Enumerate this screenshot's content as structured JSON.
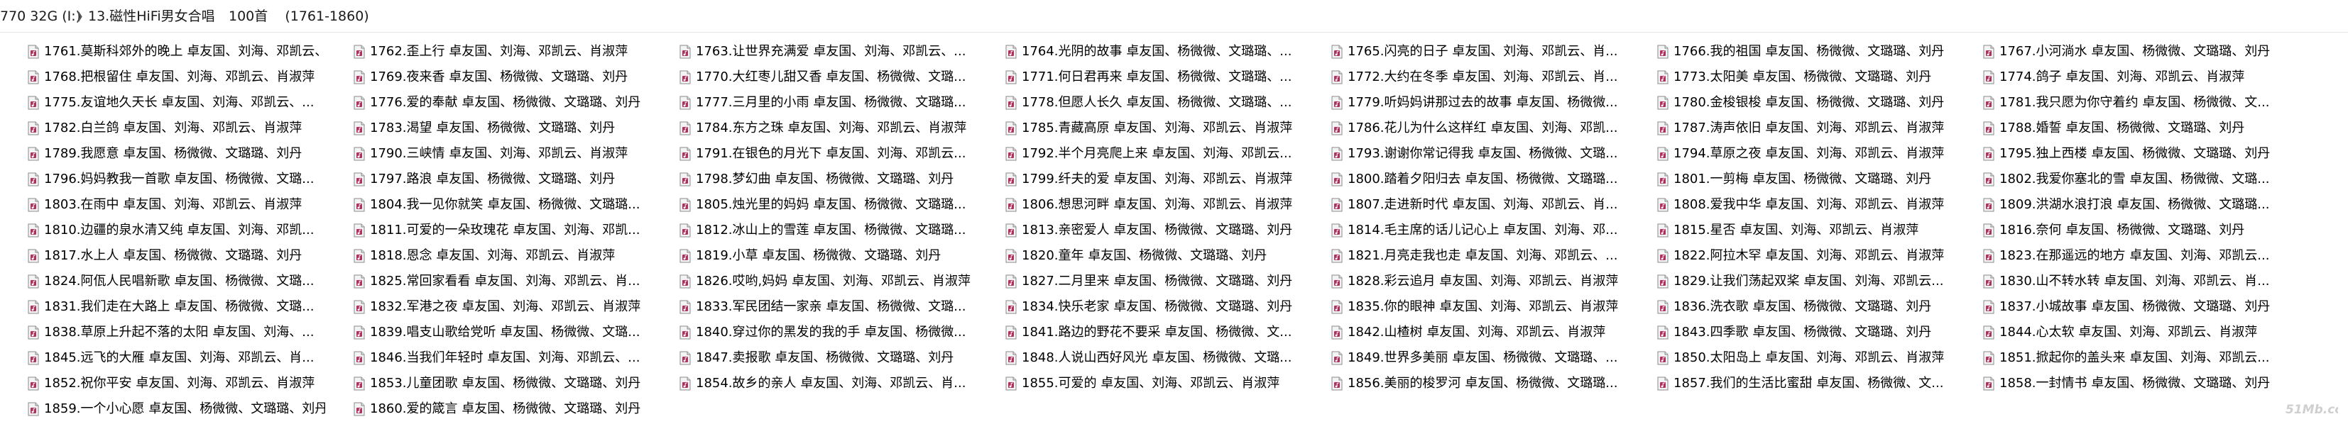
{
  "breadcrumb": {
    "drive": "770 32G (I:)",
    "folder": "13.磁性HiFi男女合唱"
  },
  "item_count": "100首",
  "range": "(1761-1860)",
  "icon": "music-file-icon",
  "accent": "#b03060",
  "files": [
    [
      "1761.莫斯科郊外的晚上 卓友国、刘海、邓凯云、...",
      "1768.把根留住 卓友国、刘海、邓凯云、肖淑萍",
      "1775.友谊地久天长 卓友国、刘海、邓凯云、...",
      "1782.白兰鸽 卓友国、刘海、邓凯云、肖淑萍",
      "1789.我愿意 卓友国、杨微微、文璐璐、刘丹",
      "1796.妈妈教我一首歌 卓友国、杨微微、文璐...",
      "1803.在雨中 卓友国、刘海、邓凯云、肖淑萍",
      "1810.边疆的泉水清又纯 卓友国、刘海、邓凯...",
      "1817.水上人 卓友国、杨微微、文璐璐、刘丹",
      "1824.阿佤人民唱新歌 卓友国、杨微微、文璐...",
      "1831.我们走在大路上 卓友国、杨微微、文璐...",
      "1838.草原上升起不落的太阳 卓友国、刘海、...",
      "1845.远飞的大雁 卓友国、刘海、邓凯云、肖...",
      "1852.祝你平安 卓友国、刘海、邓凯云、肖淑萍",
      "1859.一个小心愿 卓友国、杨微微、文璐璐、刘丹"
    ],
    [
      "1762.歪上行 卓友国、刘海、邓凯云、肖淑萍",
      "1769.夜来香 卓友国、杨微微、文璐璐、刘丹",
      "1776.爱的奉献 卓友国、杨微微、文璐璐、刘丹",
      "1783.渴望 卓友国、杨微微、文璐璐、刘丹",
      "1790.三峡情 卓友国、刘海、邓凯云、肖淑萍",
      "1797.路浪 卓友国、杨微微、文璐璐、刘丹",
      "1804.我一见你就笑 卓友国、杨微微、文璐璐...",
      "1811.可爱的一朵玫瑰花 卓友国、刘海、邓凯...",
      "1818.恩念 卓友国、刘海、邓凯云、肖淑萍",
      "1825.常回家看看 卓友国、刘海、邓凯云、肖...",
      "1832.军港之夜 卓友国、刘海、邓凯云、肖淑萍",
      "1839.唱支山歌给党听 卓友国、杨微微、文璐...",
      "1846.当我们年轻时 卓友国、刘海、邓凯云、...",
      "1853.儿童团歌 卓友国、杨微微、文璐璐、刘丹",
      "1860.爱的箴言 卓友国、杨微微、文璐璐、刘丹"
    ],
    [
      "1763.让世界充满爱 卓友国、刘海、邓凯云、...",
      "1770.大红枣儿甜又香 卓友国、杨微微、文璐...",
      "1777.三月里的小雨 卓友国、杨微微、文璐璐...",
      "1784.东方之珠 卓友国、刘海、邓凯云、肖淑萍",
      "1791.在银色的月光下 卓友国、刘海、邓凯云...",
      "1798.梦幻曲 卓友国、杨微微、文璐璐、刘丹",
      "1805.烛光里的妈妈 卓友国、杨微微、文璐璐...",
      "1812.冰山上的雪莲 卓友国、杨微微、文璐璐...",
      "1819.小草 卓友国、杨微微、文璐璐、刘丹",
      "1826.哎哟,妈妈 卓友国、刘海、邓凯云、肖淑萍",
      "1833.军民团结一家亲 卓友国、杨微微、文璐...",
      "1840.穿过你的黑发的我的手 卓友国、杨微微...",
      "1847.卖报歌 卓友国、杨微微、文璐璐、刘丹",
      "1854.故乡的亲人 卓友国、刘海、邓凯云、肖...",
      ""
    ],
    [
      "1764.光阴的故事 卓友国、杨微微、文璐璐、...",
      "1771.何日君再来 卓友国、杨微微、文璐璐、...",
      "1778.但愿人长久 卓友国、杨微微、文璐璐、...",
      "1785.青藏高原 卓友国、刘海、邓凯云、肖淑萍",
      "1792.半个月亮爬上来 卓友国、刘海、邓凯云...",
      "1799.纤夫的爱 卓友国、刘海、邓凯云、肖淑萍",
      "1806.想思河畔 卓友国、刘海、邓凯云、肖淑萍",
      "1813.亲密爱人 卓友国、杨微微、文璐璐、刘丹",
      "1820.童年 卓友国、杨微微、文璐璐、刘丹",
      "1827.二月里来 卓友国、杨微微、文璐璐、刘丹",
      "1834.快乐老家 卓友国、杨微微、文璐璐、刘丹",
      "1841.路边的野花不要采 卓友国、杨微微、文...",
      "1848.人说山西好风光 卓友国、杨微微、文璐...",
      "1855.可爱的 卓友国、刘海、邓凯云、肖淑萍",
      ""
    ],
    [
      "1765.闪亮的日子 卓友国、刘海、邓凯云、肖...",
      "1772.大约在冬季 卓友国、刘海、邓凯云、肖...",
      "1779.听妈妈讲那过去的故事 卓友国、杨微微...",
      "1786.花儿为什么这样红 卓友国、刘海、邓凯...",
      "1793.谢谢你常记得我 卓友国、杨微微、文璐...",
      "1800.踏着夕阳归去 卓友国、杨微微、文璐璐...",
      "1807.走进新时代 卓友国、刘海、邓凯云、肖...",
      "1814.毛主席的话儿记心上 卓友国、刘海、邓...",
      "1821.月亮走我也走 卓友国、刘海、邓凯云、...",
      "1828.彩云追月 卓友国、刘海、邓凯云、肖淑萍",
      "1835.你的眼神 卓友国、刘海、邓凯云、肖淑萍",
      "1842.山楂树 卓友国、刘海、邓凯云、肖淑萍",
      "1849.世界多美丽 卓友国、杨微微、文璐璐、...",
      "1856.美丽的梭罗河 卓友国、杨微微、文璐璐...",
      ""
    ],
    [
      "1766.我的祖国 卓友国、杨微微、文璐璐、刘丹",
      "1773.太阳美 卓友国、杨微微、文璐璐、刘丹",
      "1780.金梭银梭 卓友国、杨微微、文璐璐、刘丹",
      "1787.涛声依旧 卓友国、刘海、邓凯云、肖淑萍",
      "1794.草原之夜 卓友国、刘海、邓凯云、肖淑萍",
      "1801.一剪梅 卓友国、杨微微、文璐璐、刘丹",
      "1808.爱我中华 卓友国、刘海、邓凯云、肖淑萍",
      "1815.星否 卓友国、刘海、邓凯云、肖淑萍",
      "1822.阿拉木罕 卓友国、刘海、邓凯云、肖淑萍",
      "1829.让我们荡起双桨 卓友国、刘海、邓凯云...",
      "1836.洗衣歌 卓友国、杨微微、文璐璐、刘丹",
      "1843.四季歌 卓友国、杨微微、文璐璐、刘丹",
      "1850.太阳岛上 卓友国、刘海、邓凯云、肖淑萍",
      "1857.我们的生活比蜜甜 卓友国、杨微微、文...",
      ""
    ],
    [
      "1767.小河淌水 卓友国、杨微微、文璐璐、刘丹",
      "1774.鸽子 卓友国、刘海、邓凯云、肖淑萍",
      "1781.我只愿为你守着约 卓友国、杨微微、文...",
      "1788.婚誓 卓友国、杨微微、文璐璐、刘丹",
      "1795.独上西楼 卓友国、杨微微、文璐璐、刘丹",
      "1802.我爱你塞北的雪 卓友国、杨微微、文璐...",
      "1809.洪湖水浪打浪 卓友国、杨微微、文璐璐...",
      "1816.奈何 卓友国、杨微微、文璐璐、刘丹",
      "1823.在那遥远的地方 卓友国、刘海、邓凯云...",
      "1830.山不转水转 卓友国、刘海、邓凯云、肖...",
      "1837.小城故事 卓友国、杨微微、文璐璐、刘丹",
      "1844.心太软 卓友国、刘海、邓凯云、肖淑萍",
      "1851.掀起你的盖头来 卓友国、刘海、邓凯云...",
      "1858.一封情书 卓友国、杨微微、文璐璐、刘丹",
      ""
    ]
  ],
  "watermark": "51Mb.com"
}
